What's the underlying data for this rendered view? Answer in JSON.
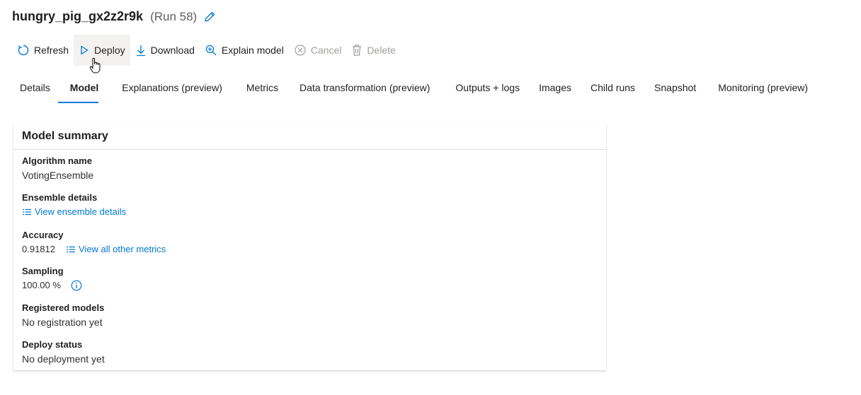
{
  "header": {
    "run_name": "hungry_pig_gx2z2r9k",
    "run_number": "(Run 58)"
  },
  "toolbar": {
    "refresh": "Refresh",
    "deploy": "Deploy",
    "download": "Download",
    "explain_model": "Explain model",
    "cancel": "Cancel",
    "delete": "Delete"
  },
  "tabs": [
    {
      "label": "Details"
    },
    {
      "label": "Model"
    },
    {
      "label": "Explanations (preview)"
    },
    {
      "label": "Metrics"
    },
    {
      "label": "Data transformation (preview)"
    },
    {
      "label": "Outputs + logs"
    },
    {
      "label": "Images"
    },
    {
      "label": "Child runs"
    },
    {
      "label": "Snapshot"
    },
    {
      "label": "Monitoring (preview)"
    }
  ],
  "active_tab": "Model",
  "summary": {
    "title": "Model summary",
    "algorithm_label": "Algorithm name",
    "algorithm_value": "VotingEnsemble",
    "ensemble_label": "Ensemble details",
    "ensemble_link": "View ensemble details",
    "accuracy_label": "Accuracy",
    "accuracy_value": "0.91812",
    "metrics_link": "View all other metrics",
    "sampling_label": "Sampling",
    "sampling_value": "100.00 %",
    "registered_label": "Registered models",
    "registered_value": "No registration yet",
    "deploy_label": "Deploy status",
    "deploy_value": "No deployment yet"
  },
  "colors": {
    "accent": "#0078d4",
    "disabled": "#a19f9d",
    "hover_bg": "#f3f2f1"
  },
  "icons": [
    "edit-icon",
    "refresh-icon",
    "play-icon",
    "download-icon",
    "explain-zoom-icon",
    "cancel-icon",
    "delete-icon",
    "list-icon",
    "info-icon",
    "hand-cursor-icon"
  ]
}
